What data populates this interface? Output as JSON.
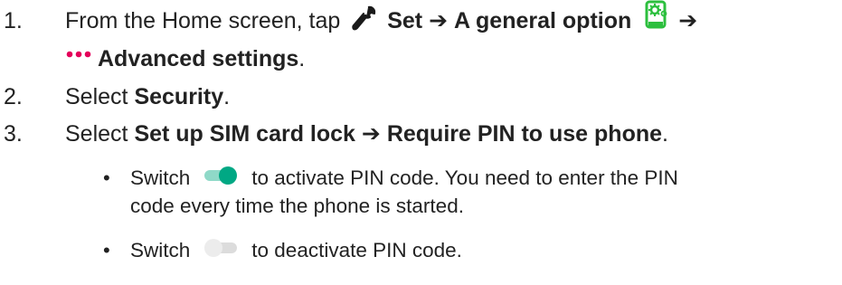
{
  "steps": [
    {
      "number": "1.",
      "line1_prefix": "From the Home screen, tap",
      "set_label": "Set",
      "arrow": "➔",
      "general_option_label": "A general option",
      "more_label": "Advanced settings",
      "line2_suffix": "."
    },
    {
      "number": "2.",
      "prefix": "Select",
      "bold": "Security",
      "suffix": "."
    },
    {
      "number": "3.",
      "prefix": "Select",
      "bold1": "Set up SIM card lock",
      "arrow": "➔",
      "bold2": "Require PIN to use phone",
      "suffix": "."
    }
  ],
  "bullets": [
    {
      "marker": "•",
      "prefix": "Switch",
      "toggle_state": "on",
      "line1_text": "to activate PIN code. You need to enter the PIN",
      "line2_text": "code every time the phone is started."
    },
    {
      "marker": "•",
      "prefix": "Switch",
      "toggle_state": "off",
      "line1_text": "to deactivate PIN code."
    }
  ],
  "icons": {
    "wrench": "wrench-icon",
    "general_option": "phone-gear-icon",
    "more": "more-dots-icon",
    "toggle_on": "toggle-on-icon",
    "toggle_off": "toggle-off-icon"
  },
  "colors": {
    "text": "#222222",
    "toggle_on_track": "#8fd9c8",
    "toggle_on_thumb": "#00a884",
    "toggle_off_track": "#dcdcdc",
    "toggle_off_thumb": "#ececec",
    "dots": "#e4005a",
    "gear_phone": "#2cbf3e"
  }
}
